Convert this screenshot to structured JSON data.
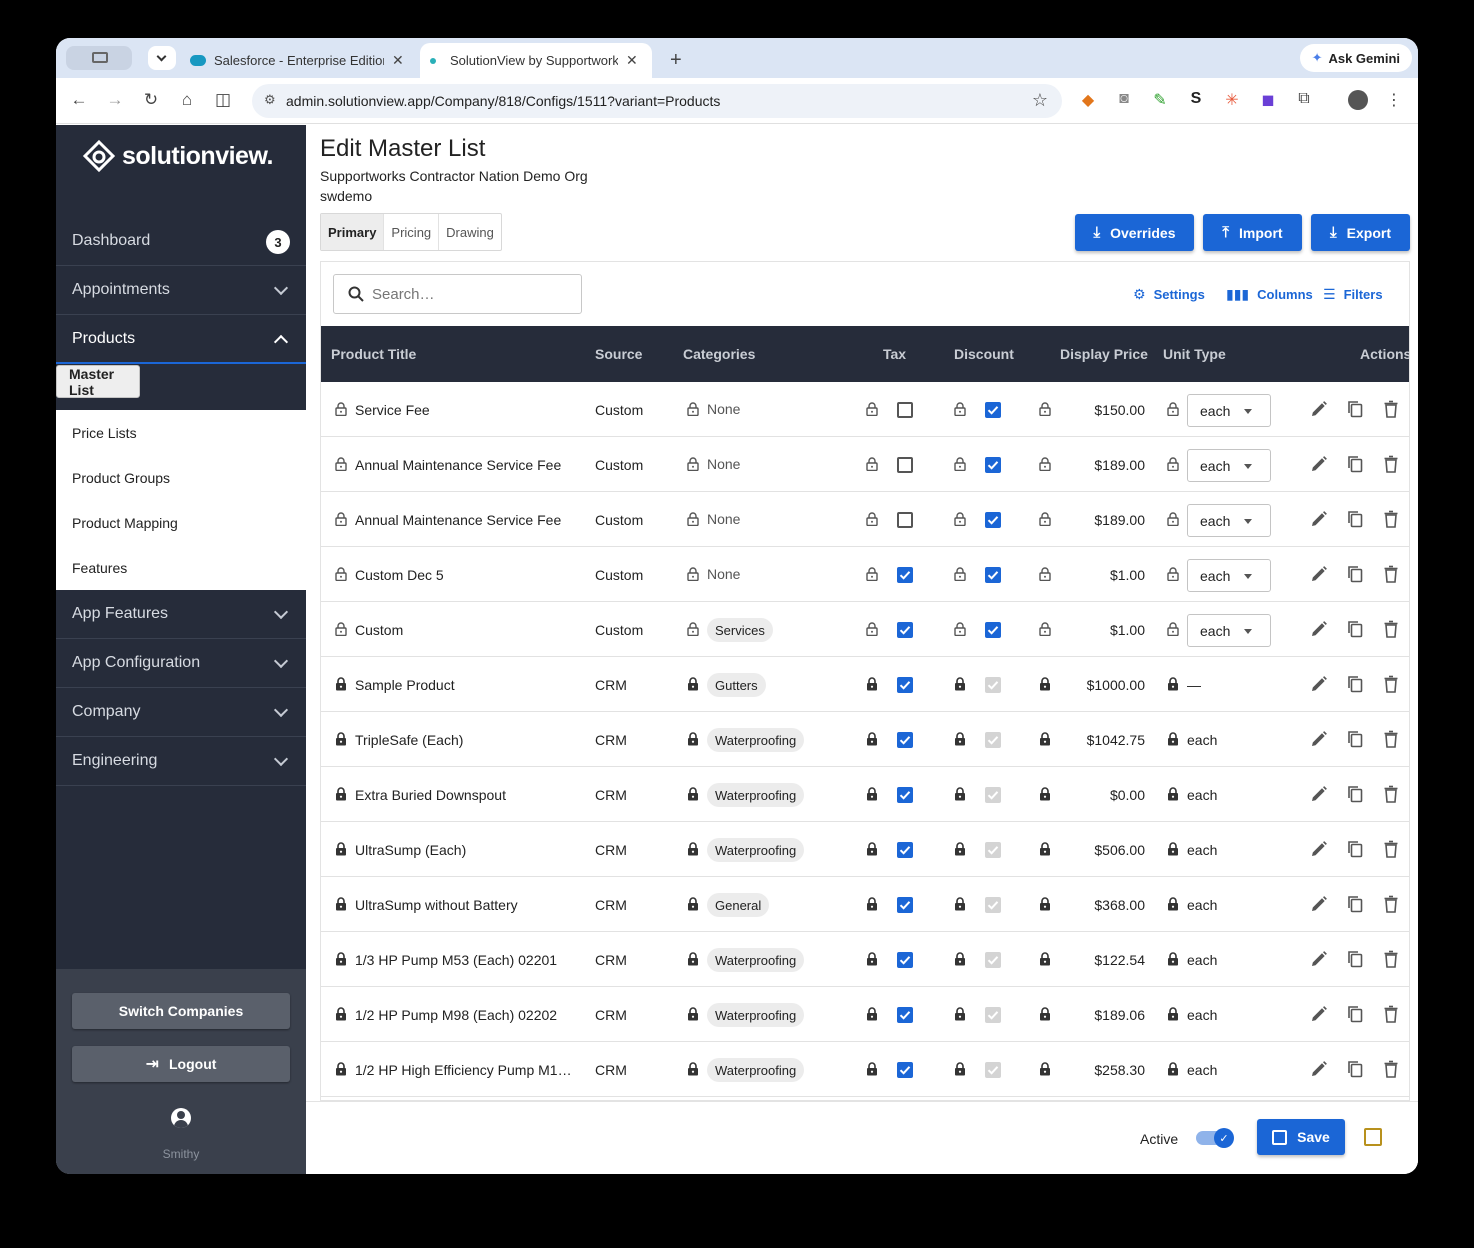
{
  "browser": {
    "tabs": [
      {
        "title": "Salesforce - Enterprise Edition"
      },
      {
        "title": "SolutionView by Supportworks"
      }
    ],
    "ask_gemini": "Ask Gemini",
    "url": "admin.solutionview.app/Company/818/Configs/1511?variant=Products"
  },
  "sidebar": {
    "brand": "solutionview.",
    "dashboard": {
      "label": "Dashboard",
      "badge": "3"
    },
    "sections": [
      {
        "label": "Appointments"
      },
      {
        "label": "Products"
      },
      {
        "label": "App Features"
      },
      {
        "label": "App Configuration"
      },
      {
        "label": "Company"
      },
      {
        "label": "Engineering"
      }
    ],
    "products_items": [
      "Master List",
      "Price Lists",
      "Product Groups",
      "Product Mapping",
      "Features"
    ],
    "switch_companies": "Switch Companies",
    "logout": "Logout",
    "user": "Smithy"
  },
  "page": {
    "title": "Edit Master List",
    "org": "Supportworks Contractor Nation Demo Org",
    "code": "swdemo",
    "tabs": [
      "Primary",
      "Pricing",
      "Drawing"
    ],
    "actions": {
      "overrides": "Overrides",
      "import": "Import",
      "export": "Export"
    }
  },
  "grid": {
    "search_placeholder": "Search…",
    "tools": {
      "settings": "Settings",
      "columns": "Columns",
      "filters": "Filters"
    },
    "columns": [
      "Product Title",
      "Source",
      "Categories",
      "Tax",
      "Discount",
      "Display Price",
      "Unit Type",
      "Actions"
    ],
    "rows": [
      {
        "title": "Service Fee",
        "source": "Custom",
        "category": "None",
        "category_chip": false,
        "tax": false,
        "discount": true,
        "discount_disabled": false,
        "price": "$150.00",
        "unit": "each",
        "unit_select": true,
        "locked": false
      },
      {
        "title": "Annual Maintenance Service Fee",
        "source": "Custom",
        "category": "None",
        "category_chip": false,
        "tax": false,
        "discount": true,
        "discount_disabled": false,
        "price": "$189.00",
        "unit": "each",
        "unit_select": true,
        "locked": false
      },
      {
        "title": "Annual Maintenance Service Fee",
        "source": "Custom",
        "category": "None",
        "category_chip": false,
        "tax": false,
        "discount": true,
        "discount_disabled": false,
        "price": "$189.00",
        "unit": "each",
        "unit_select": true,
        "locked": false
      },
      {
        "title": "Custom Dec 5",
        "source": "Custom",
        "category": "None",
        "category_chip": false,
        "tax": true,
        "discount": true,
        "discount_disabled": false,
        "price": "$1.00",
        "unit": "each",
        "unit_select": true,
        "locked": false
      },
      {
        "title": "Custom",
        "source": "Custom",
        "category": "Services",
        "category_chip": true,
        "tax": true,
        "discount": true,
        "discount_disabled": false,
        "price": "$1.00",
        "unit": "each",
        "unit_select": true,
        "locked": false
      },
      {
        "title": "Sample Product",
        "source": "CRM",
        "category": "Gutters",
        "category_chip": true,
        "tax": true,
        "discount": true,
        "discount_disabled": true,
        "price": "$1000.00",
        "unit": "—",
        "unit_select": false,
        "locked": true
      },
      {
        "title": "TripleSafe (Each)",
        "source": "CRM",
        "category": "Waterproofing",
        "category_chip": true,
        "tax": true,
        "discount": true,
        "discount_disabled": true,
        "price": "$1042.75",
        "unit": "each",
        "unit_select": false,
        "locked": true
      },
      {
        "title": "Extra Buried Downspout",
        "source": "CRM",
        "category": "Waterproofing",
        "category_chip": true,
        "tax": true,
        "discount": true,
        "discount_disabled": true,
        "price": "$0.00",
        "unit": "each",
        "unit_select": false,
        "locked": true
      },
      {
        "title": "UltraSump (Each)",
        "source": "CRM",
        "category": "Waterproofing",
        "category_chip": true,
        "tax": true,
        "discount": true,
        "discount_disabled": true,
        "price": "$506.00",
        "unit": "each",
        "unit_select": false,
        "locked": true
      },
      {
        "title": "UltraSump without Battery",
        "source": "CRM",
        "category": "General",
        "category_chip": true,
        "tax": true,
        "discount": true,
        "discount_disabled": true,
        "price": "$368.00",
        "unit": "each",
        "unit_select": false,
        "locked": true
      },
      {
        "title": "1/3 HP Pump M53 (Each) 02201",
        "source": "CRM",
        "category": "Waterproofing",
        "category_chip": true,
        "tax": true,
        "discount": true,
        "discount_disabled": true,
        "price": "$122.54",
        "unit": "each",
        "unit_select": false,
        "locked": true
      },
      {
        "title": "1/2 HP Pump M98 (Each) 02202",
        "source": "CRM",
        "category": "Waterproofing",
        "category_chip": true,
        "tax": true,
        "discount": true,
        "discount_disabled": true,
        "price": "$189.06",
        "unit": "each",
        "unit_select": false,
        "locked": true
      },
      {
        "title": "1/2 HP High Efficiency Pump M1…",
        "source": "CRM",
        "category": "Waterproofing",
        "category_chip": true,
        "tax": true,
        "discount": true,
        "discount_disabled": true,
        "price": "$258.30",
        "unit": "each",
        "unit_select": false,
        "locked": true
      }
    ]
  },
  "footer": {
    "active_label": "Active",
    "active": true,
    "save": "Save"
  },
  "colors": {
    "accent": "#1b66d6",
    "sidebar": "#262c3a",
    "header": "#262c3a"
  }
}
